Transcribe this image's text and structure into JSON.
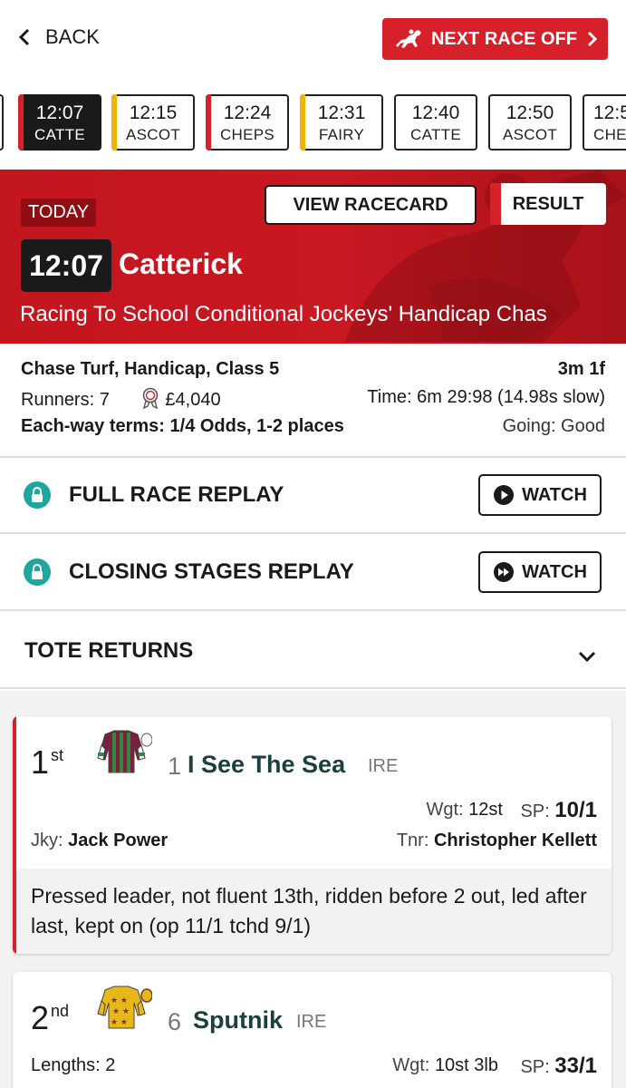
{
  "nav": {
    "back_label": "BACK",
    "next_race_label": "NEXT RACE OFF"
  },
  "race_tabs": [
    {
      "time": "12:07",
      "course": "CATTE",
      "active": true,
      "bar_color": "#d6202a"
    },
    {
      "time": "12:15",
      "course": "ASCOT",
      "active": false,
      "bar_color": "#f0b400"
    },
    {
      "time": "12:24",
      "course": "CHEPS",
      "active": false,
      "bar_color": "#d6202a"
    },
    {
      "time": "12:31",
      "course": "FAIRY",
      "active": false,
      "bar_color": "#f0b400"
    },
    {
      "time": "12:40",
      "course": "CATTE",
      "active": false,
      "bar_color": ""
    },
    {
      "time": "12:50",
      "course": "ASCOT",
      "active": false,
      "bar_color": ""
    },
    {
      "time": "12:5",
      "course": "CHE",
      "active": false,
      "bar_color": ""
    }
  ],
  "hero": {
    "today_label": "TODAY",
    "view_racecard_label": "VIEW RACECARD",
    "result_label": "RESULT",
    "time": "12:07",
    "course": "Catterick",
    "race_name": "Racing To School Conditional Jockeys' Handicap Chas"
  },
  "info": {
    "race_type": "Chase Turf, Handicap, Class 5",
    "distance": "3m 1f",
    "runners": "Runners: 7",
    "prize": "£4,040",
    "time": "Time: 6m 29:98 (14.98s slow)",
    "each_way": "Each-way terms: 1/4 Odds, 1-2 places",
    "going": "Going: Good"
  },
  "replays": [
    {
      "label": "FULL RACE REPLAY",
      "button": "WATCH",
      "icon": "play-icon"
    },
    {
      "label": "CLOSING STAGES REPLAY",
      "button": "WATCH",
      "icon": "fast-forward-icon"
    }
  ],
  "tote": {
    "label": "TOTE RETURNS"
  },
  "results": [
    {
      "pos": "1",
      "suffix": "st",
      "number": "1",
      "horse": "I See The Sea",
      "country": "IRE",
      "wgt_label": "Wgt:",
      "wgt": "12st",
      "sp_label": "SP:",
      "sp": "10/1",
      "jky_label": "Jky:",
      "jockey": "Jack Power",
      "tnr_label": "Tnr:",
      "trainer": "Christopher Kellett",
      "comment": "Pressed leader, not fluent 13th, ridden before 2 out, led after last, kept on (op 11/1 tchd 9/1)",
      "silk": "maroon-green-stripes"
    },
    {
      "pos": "2",
      "suffix": "nd",
      "number": "6",
      "horse": "Sputnik",
      "country": "IRE",
      "lengths": "Lengths: 2",
      "wgt_label": "Wgt:",
      "wgt": "10st 3lb",
      "sp_label": "SP:",
      "sp": "33/1",
      "silk": "yellow-brown-stars"
    }
  ]
}
